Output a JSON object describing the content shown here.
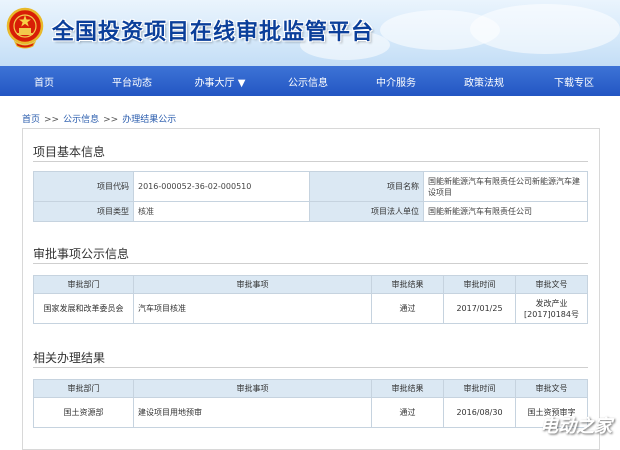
{
  "header": {
    "site_title": "全国投资项目在线审批监管平台",
    "emblem_icon": "national-emblem-icon"
  },
  "nav": {
    "items": [
      "首页",
      "平台动态",
      "办事大厅 ▼",
      "公示信息",
      "中介服务",
      "政策法规",
      "下载专区"
    ]
  },
  "breadcrumb": {
    "items": [
      "首页",
      "公示信息",
      "办理结果公示"
    ],
    "separator": ">>"
  },
  "basic_info": {
    "title": "项目基本信息",
    "code_label": "项目代码",
    "code_value": "2016-000052-36-02-000510",
    "name_label": "项目名称",
    "name_value": "国能新能源汽车有限责任公司新能源汽车建设项目",
    "type_label": "项目类型",
    "type_value": "核准",
    "legal_label": "项目法人单位",
    "legal_value": "国能新能源汽车有限责任公司"
  },
  "approval": {
    "title": "审批事项公示信息",
    "headers": [
      "审批部门",
      "审批事项",
      "审批结果",
      "审批时间",
      "审批文号"
    ],
    "rows": [
      {
        "dept": "国家发展和改革委员会",
        "item": "汽车项目核准",
        "result": "通过",
        "date": "2017/01/25",
        "doc": "发改产业[2017]0184号"
      }
    ]
  },
  "related": {
    "title": "相关办理结果",
    "headers": [
      "审批部门",
      "审批事项",
      "审批结果",
      "审批时间",
      "审批文号"
    ],
    "rows": [
      {
        "dept": "国土资源部",
        "item": "建设项目用地预审",
        "result": "通过",
        "date": "2016/08/30",
        "doc": "国土资预审字"
      }
    ]
  },
  "watermark": "电动之家",
  "colors": {
    "nav_bg": "#2a5dc8",
    "title_blue": "#0b3f9a",
    "label_bg": "#dbe8f3",
    "link_blue": "#2a5cad"
  }
}
